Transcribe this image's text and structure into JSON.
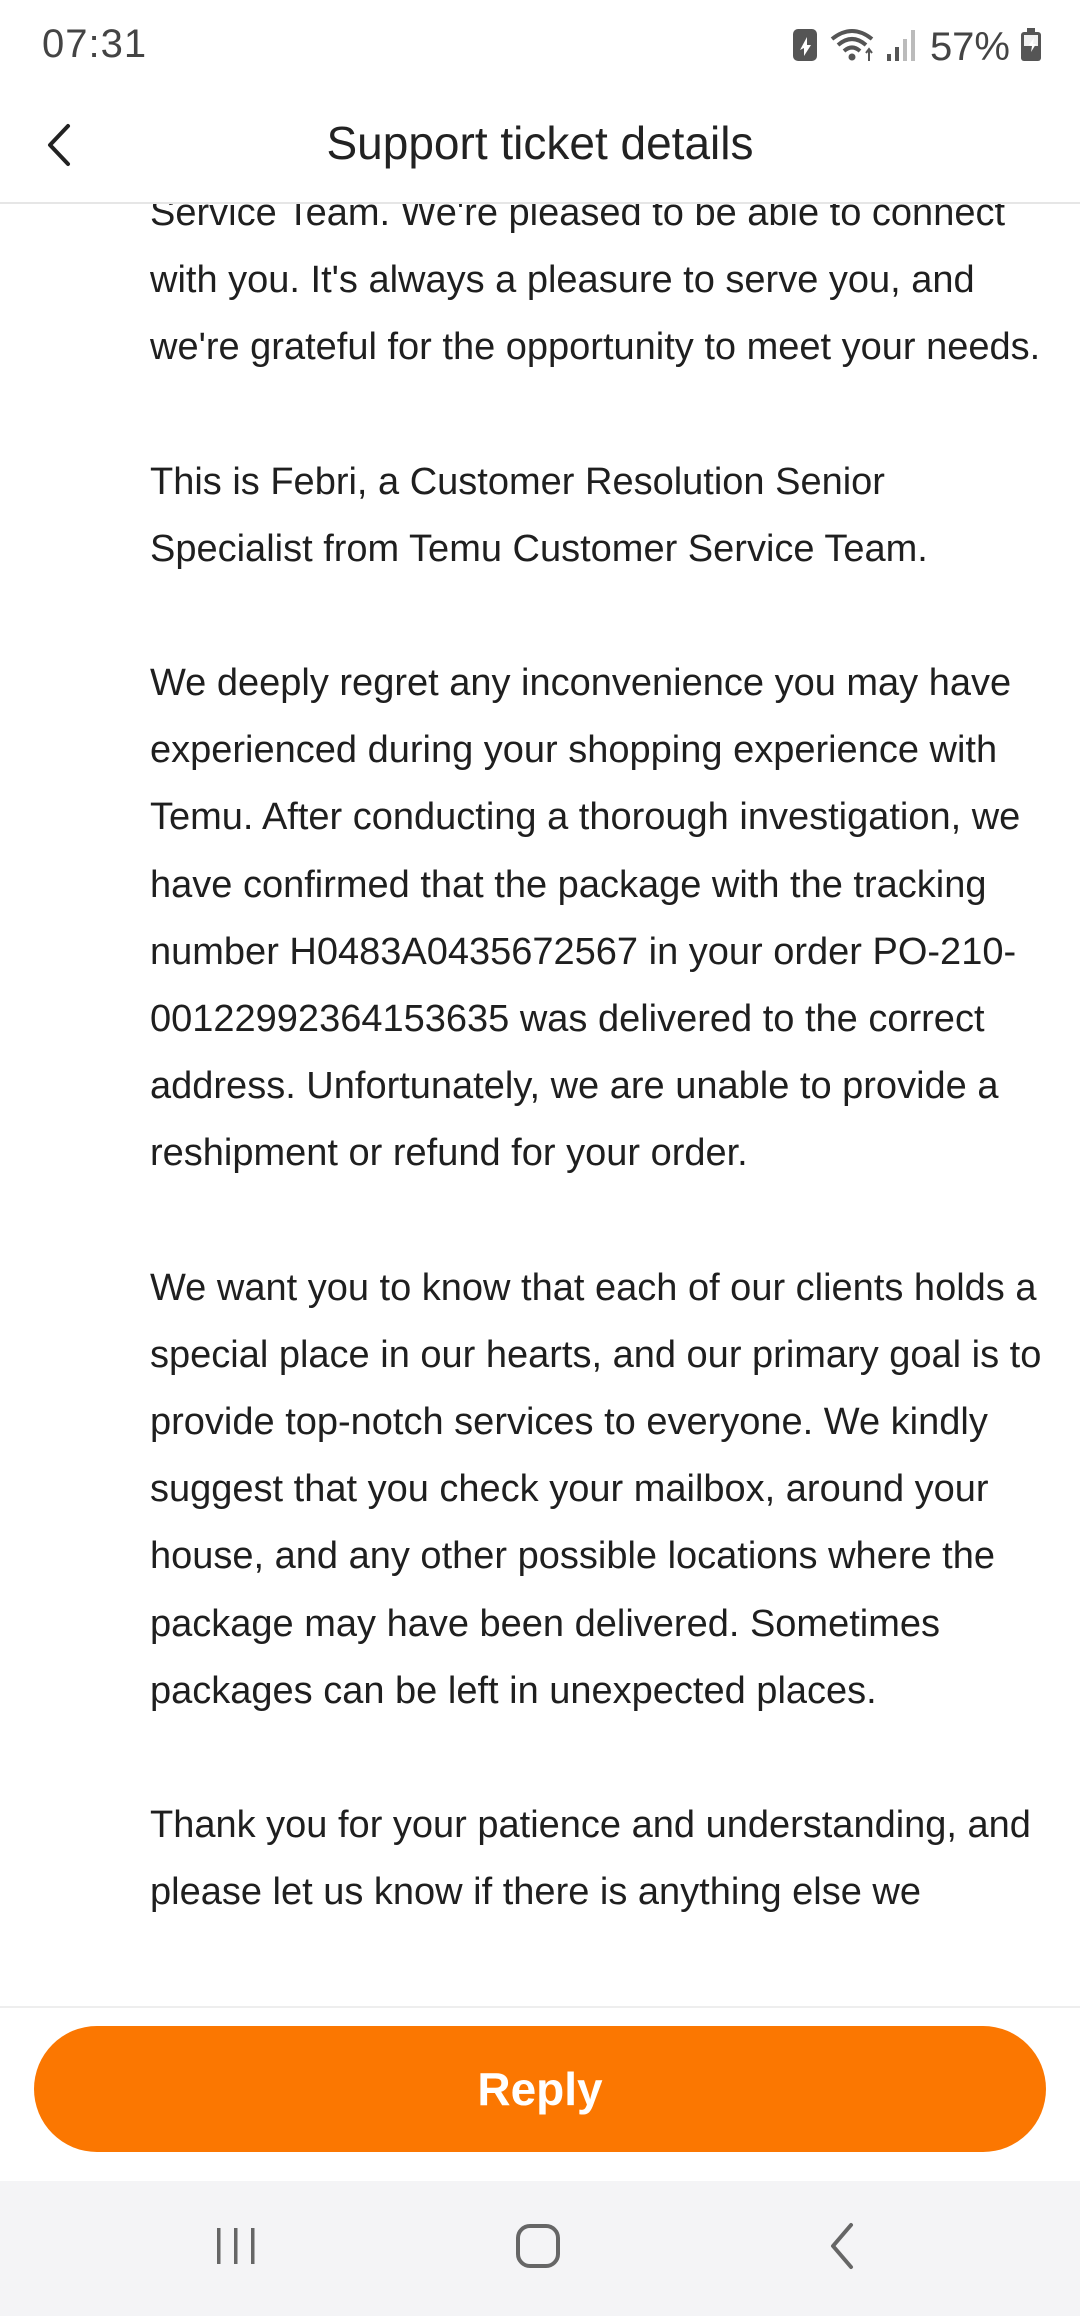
{
  "status_bar": {
    "time": "07:31",
    "battery_percent": "57%",
    "icons": [
      "battery-saver-icon",
      "wifi-icon",
      "signal-icon",
      "battery-charging-icon"
    ]
  },
  "header": {
    "title": "Support ticket details",
    "back_icon": "chevron-left-icon"
  },
  "message": {
    "paragraphs": [
      "Service Team. We're pleased to be able to connect with you. It's always a pleasure to serve you, and we're grateful for the opportunity to meet your needs.",
      "This is Febri, a Customer Resolution Senior Specialist from Temu Customer Service Team.",
      "We deeply regret any inconvenience you may have experienced during your shopping experience with Temu. After conducting a thorough investigation, we have confirmed that the package with the tracking number H0483A0435672567 in your order PO-210-00122992364153635 was delivered to the correct address. Unfortunately, we are unable to provide a reshipment or refund for your order.",
      "We want you to know that each of our clients holds a special place in our hearts, and our primary goal is to provide top-notch services to everyone. We kindly suggest that you check your mailbox, around your house, and any other possible locations where the package may have been delivered. Sometimes packages can be left in unexpected places.",
      "Thank you for your patience and understanding, and please let us know if there is anything else we"
    ]
  },
  "footer": {
    "reply_label": "Reply",
    "accent_color": "#fb7701"
  },
  "nav_bar": {
    "icons": [
      "recent-apps-icon",
      "home-icon",
      "back-icon"
    ]
  }
}
